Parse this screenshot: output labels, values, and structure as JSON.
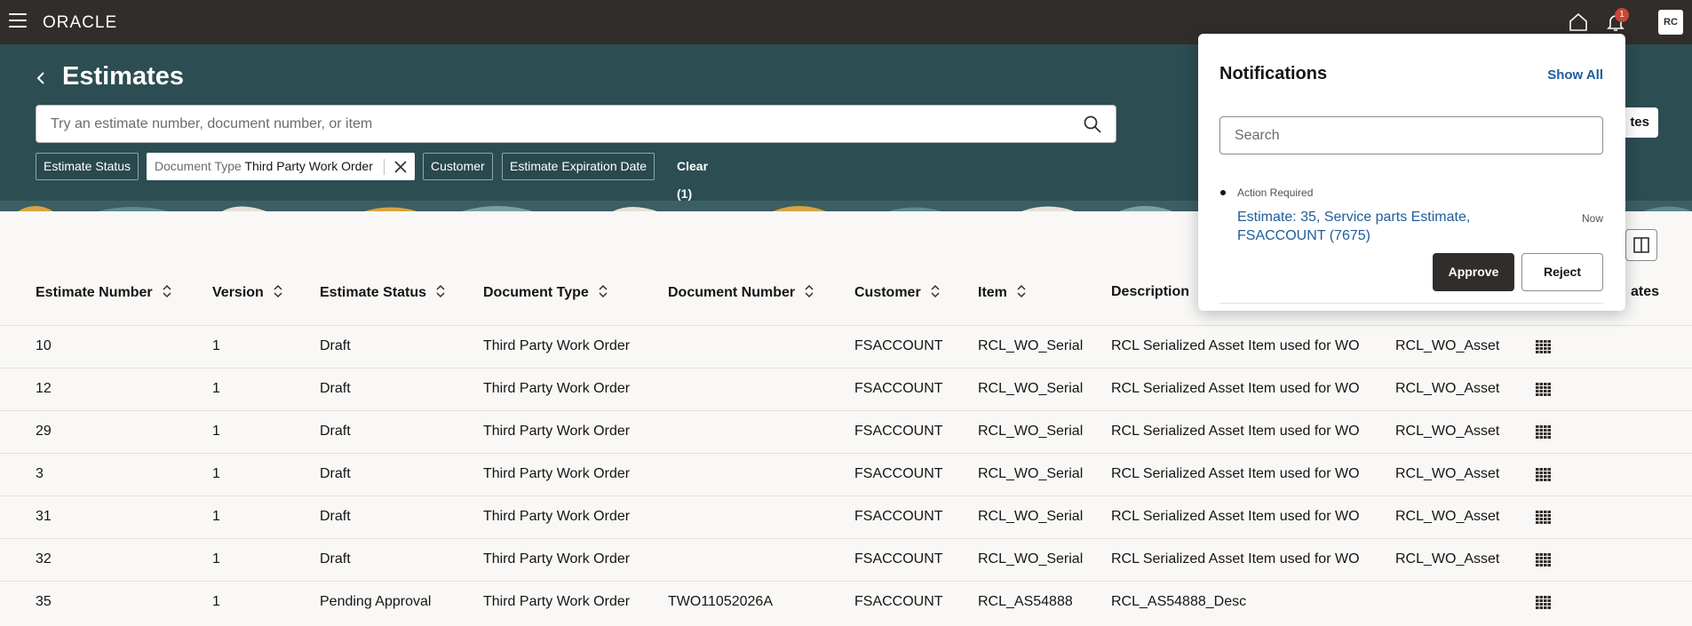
{
  "topbar": {
    "logo": "ORACLE",
    "notification_count": "1",
    "avatar_initials": "RC"
  },
  "header": {
    "title": "Estimates",
    "search_placeholder": "Try an estimate number, document number, or item",
    "right_button_label": "tes",
    "filters": {
      "estimate_status": "Estimate Status",
      "document_type_key": "Document Type",
      "document_type_value": "Third Party Work Order",
      "customer": "Customer",
      "expiration_date": "Estimate Expiration Date",
      "clear": "Clear (1)"
    }
  },
  "table": {
    "columns": [
      "Estimate Number",
      "Version",
      "Estimate Status",
      "Document Type",
      "Document Number",
      "Customer",
      "Item",
      "Description",
      "ates"
    ],
    "rows": [
      {
        "estimate_number": "10",
        "version": "1",
        "status": "Draft",
        "document_type": "Third Party Work Order",
        "document_number": "",
        "customer": "FSACCOUNT",
        "item": "RCL_WO_Serial",
        "description": "RCL Serialized Asset Item used for WO",
        "asset": "RCL_WO_Asset"
      },
      {
        "estimate_number": "12",
        "version": "1",
        "status": "Draft",
        "document_type": "Third Party Work Order",
        "document_number": "",
        "customer": "FSACCOUNT",
        "item": "RCL_WO_Serial",
        "description": "RCL Serialized Asset Item used for WO",
        "asset": "RCL_WO_Asset"
      },
      {
        "estimate_number": "29",
        "version": "1",
        "status": "Draft",
        "document_type": "Third Party Work Order",
        "document_number": "",
        "customer": "FSACCOUNT",
        "item": "RCL_WO_Serial",
        "description": "RCL Serialized Asset Item used for WO",
        "asset": "RCL_WO_Asset"
      },
      {
        "estimate_number": "3",
        "version": "1",
        "status": "Draft",
        "document_type": "Third Party Work Order",
        "document_number": "",
        "customer": "FSACCOUNT",
        "item": "RCL_WO_Serial",
        "description": "RCL Serialized Asset Item used for WO",
        "asset": "RCL_WO_Asset"
      },
      {
        "estimate_number": "31",
        "version": "1",
        "status": "Draft",
        "document_type": "Third Party Work Order",
        "document_number": "",
        "customer": "FSACCOUNT",
        "item": "RCL_WO_Serial",
        "description": "RCL Serialized Asset Item used for WO",
        "asset": "RCL_WO_Asset"
      },
      {
        "estimate_number": "32",
        "version": "1",
        "status": "Draft",
        "document_type": "Third Party Work Order",
        "document_number": "",
        "customer": "FSACCOUNT",
        "item": "RCL_WO_Serial",
        "description": "RCL Serialized Asset Item used for WO",
        "asset": "RCL_WO_Asset"
      },
      {
        "estimate_number": "35",
        "version": "1",
        "status": "Pending Approval",
        "document_type": "Third Party Work Order",
        "document_number": "TWO11052026A",
        "customer": "FSACCOUNT",
        "item": "RCL_AS54888",
        "description": "RCL_AS54888_Desc",
        "asset": ""
      }
    ]
  },
  "notifications": {
    "title": "Notifications",
    "show_all": "Show All",
    "search_placeholder": "Search",
    "item": {
      "label": "Action Required",
      "link": "Estimate: 35, Service parts Estimate, FSACCOUNT (7675)",
      "time": "Now",
      "approve": "Approve",
      "reject": "Reject"
    }
  },
  "colors": {
    "topbar": "#312d2a",
    "header": "#2c4d52",
    "link": "#1d5d9b",
    "badge": "#c74634"
  }
}
